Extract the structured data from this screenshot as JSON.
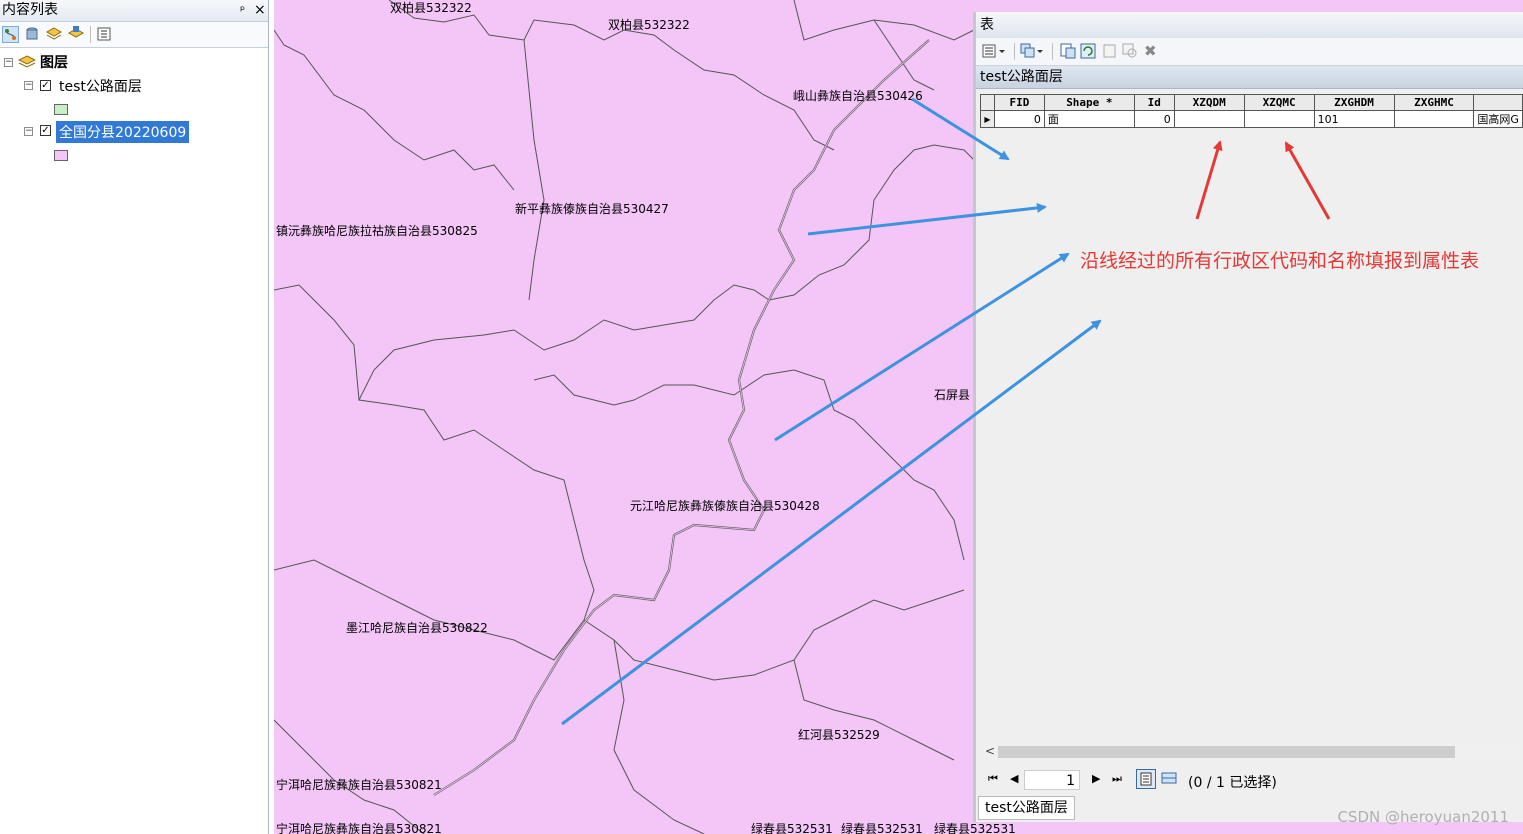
{
  "toc": {
    "title": "内容列表",
    "pin": "ᵖ",
    "close": "×",
    "root_label": "图层",
    "layers": [
      {
        "name": "test公路面层",
        "checked": true,
        "swatch": "#c8f0c8",
        "selected": false
      },
      {
        "name": "全国分县20220609",
        "checked": true,
        "swatch": "#f3c6f7",
        "selected": true
      }
    ]
  },
  "map": {
    "fill": "#f3c6f7",
    "labels": [
      "双柏县532322",
      "双柏县532322",
      "峨山彝族自治县530426",
      "新平彝族傣族自治县530427",
      "镇沅彝族哈尼族拉祜族自治县530825",
      "石屏县",
      "元江哈尼族彝族傣族自治县530428",
      "墨江哈尼族自治县530822",
      "红河县532529",
      "宁洱哈尼族彝族自治县530821",
      "宁洱哈尼族彝族自治县530821",
      "绿春县532531",
      "绿春县532531",
      "绿春县532531"
    ]
  },
  "table": {
    "window_title": "表",
    "layer_name": "test公路面层",
    "columns": [
      "FID",
      "Shape *",
      "Id",
      "XZQDM",
      "XZQMC",
      "ZXGHDM",
      "ZXGHMC",
      ""
    ],
    "rows": [
      {
        "FID": "0",
        "Shape": "面",
        "Id": "0",
        "XZQDM": "",
        "XZQMC": "",
        "ZXGHDM": "101",
        "ZXGHMC": "",
        "extra": "国高网G"
      }
    ],
    "record_number": "1",
    "selection_status": "(0 / 1 已选择)",
    "tab_label": "test公路面层"
  },
  "annotation": {
    "note": "沿线经过的所有行政区代码和名称填报到属性表",
    "arrow_color_blue": "#3d93e0",
    "arrow_color_red": "#e53935"
  },
  "watermark": "CSDN @heroyuan2011"
}
